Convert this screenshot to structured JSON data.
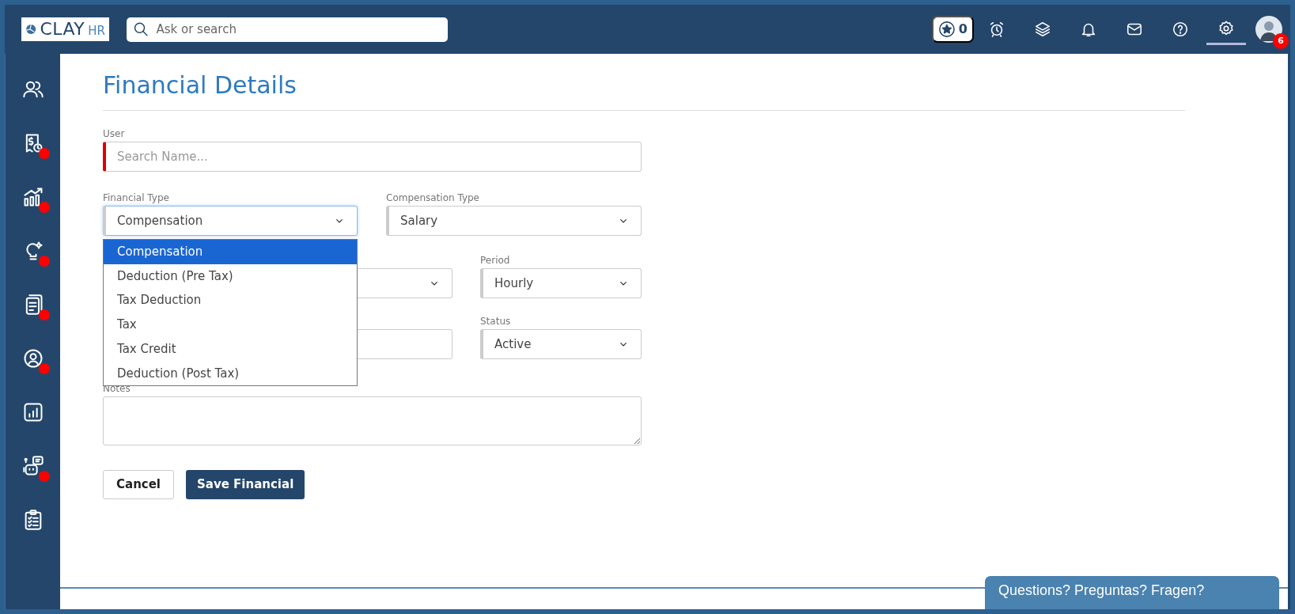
{
  "header": {
    "logo": {
      "text": "CLAY",
      "suffix": "HR"
    },
    "search": {
      "placeholder": "Ask or search"
    },
    "points": "0",
    "icons": [
      {
        "kind": "alarm",
        "selected": false
      },
      {
        "kind": "layers",
        "selected": false
      },
      {
        "kind": "bell",
        "selected": false
      },
      {
        "kind": "mail",
        "selected": false
      },
      {
        "kind": "help",
        "selected": false
      },
      {
        "kind": "settings",
        "selected": true
      }
    ],
    "profile": {
      "badge": "6"
    }
  },
  "sidebar": {
    "items": [
      {
        "kind": "people",
        "alert": false
      },
      {
        "kind": "payroll",
        "alert": true
      },
      {
        "kind": "growth",
        "alert": true
      },
      {
        "kind": "idea",
        "alert": true
      },
      {
        "kind": "documents",
        "alert": true
      },
      {
        "kind": "profile",
        "alert": true
      },
      {
        "kind": "report",
        "alert": false
      },
      {
        "kind": "bot",
        "alert": true
      },
      {
        "kind": "checklist",
        "alert": false
      }
    ]
  },
  "page": {
    "title": "Financial Details"
  },
  "form": {
    "user": {
      "label": "User",
      "placeholder": "Search Name...",
      "required": true
    },
    "financial_type": {
      "label": "Financial Type",
      "value": "Compensation",
      "expanded": true,
      "options": [
        {
          "label": "Compensation",
          "selected": true
        },
        {
          "label": "Deduction (Pre Tax)",
          "selected": false
        },
        {
          "label": "Tax Deduction",
          "selected": false
        },
        {
          "label": "Tax",
          "selected": false
        },
        {
          "label": "Tax Credit",
          "selected": false
        },
        {
          "label": "Deduction (Post Tax)",
          "selected": false
        }
      ]
    },
    "compensation_type": {
      "label": "Compensation Type",
      "value": "Salary"
    },
    "field_3": {
      "kind": "select"
    },
    "period": {
      "label": "Period",
      "value": "Hourly"
    },
    "field_4": {
      "kind": "input"
    },
    "status": {
      "label": "Status",
      "value": "Active"
    },
    "notes": {
      "label": "Notes"
    },
    "buttons": [
      {
        "label": "Cancel",
        "kind": "secondary"
      },
      {
        "label": "Save Financial",
        "kind": "primary"
      }
    ]
  },
  "chat": {
    "label": "Questions? Preguntas? Fragen?"
  }
}
